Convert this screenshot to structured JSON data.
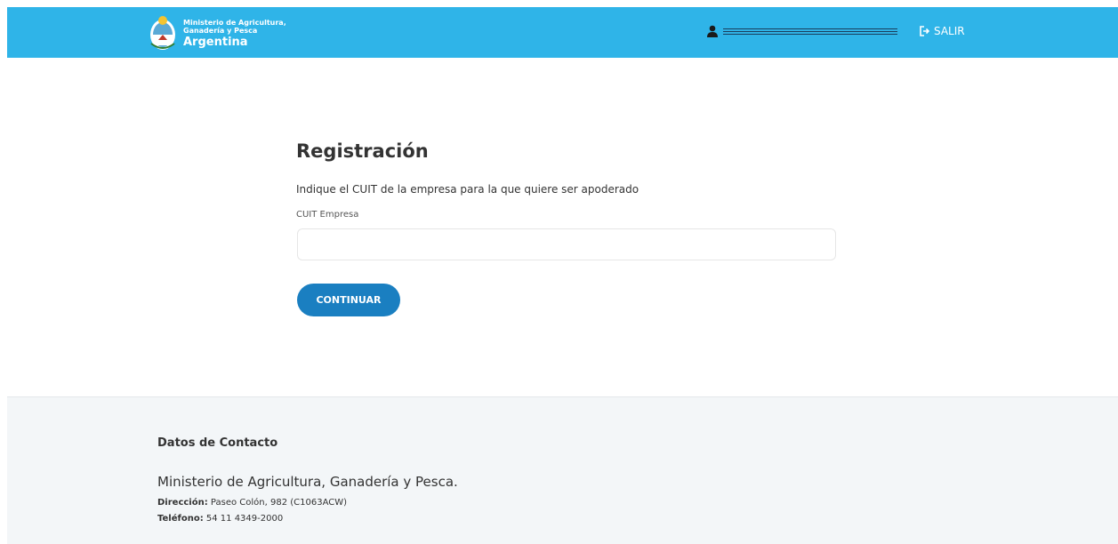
{
  "header": {
    "brand_small": "Ministerio de Agricultura, Ganadería y Pesca",
    "brand_big": "Argentina",
    "logout_label": "SALIR",
    "colors": {
      "bar": "#2fb4e8",
      "text": "#ffffff"
    }
  },
  "main": {
    "title": "Registración",
    "instruction": "Indique el CUIT de la empresa para la que quiere ser apoderado",
    "field_label": "CUIT Empresa",
    "field_value": "",
    "continue_label": "CONTINUAR",
    "colors": {
      "button": "#1a7fc1"
    }
  },
  "footer": {
    "heading": "Datos de Contacto",
    "org": "Ministerio de Agricultura, Ganadería y Pesca.",
    "address_label": "Dirección:",
    "address_value": "Paseo Colón, 982 (C1063ACW)",
    "phone_label": "Teléfono:",
    "phone_value": "54 11 4349-2000"
  },
  "icons": [
    "coat-of-arms-icon",
    "user-icon",
    "logout-icon"
  ]
}
